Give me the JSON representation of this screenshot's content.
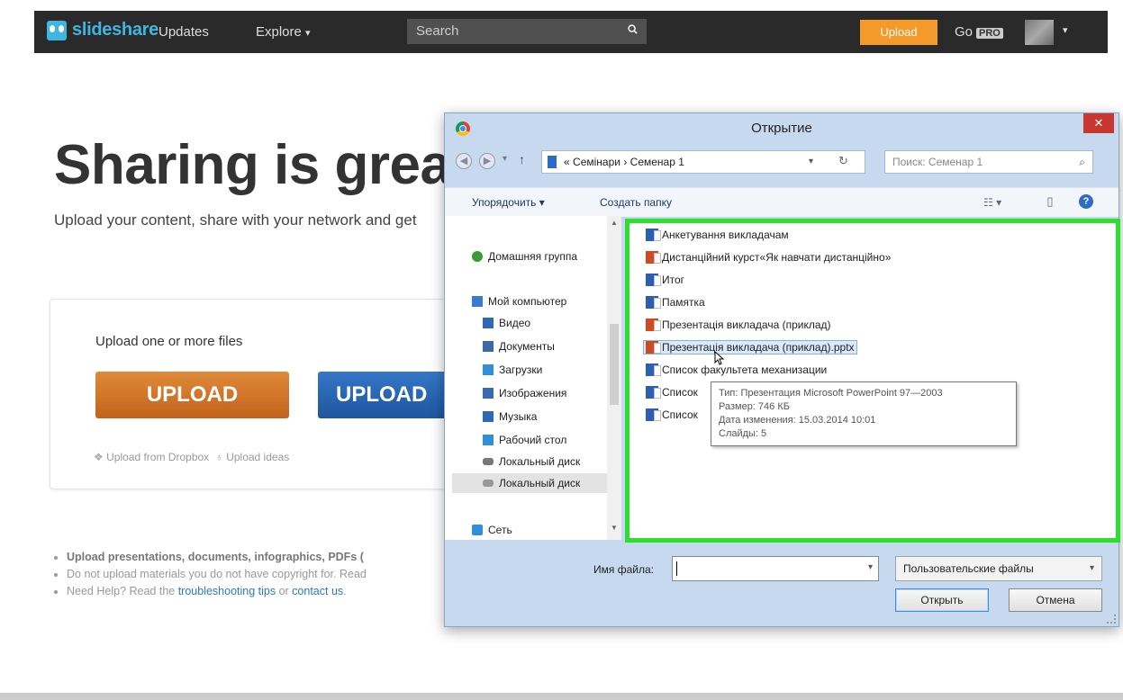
{
  "nav": {
    "logo": "slideshare",
    "updates": "Updates",
    "explore": "Explore",
    "explore_caret": "▾",
    "search_placeholder": "Search",
    "upload": "Upload",
    "go": "Go",
    "pro": "PRO",
    "avatar_caret": "▾"
  },
  "hero": {
    "title": "Sharing is great",
    "subtitle": "Upload your content, share with your network and get"
  },
  "card": {
    "title": "Upload one or more files",
    "upload_primary": "UPLOAD",
    "upload_secondary": "UPLOAD",
    "dropbox": "Upload from Dropbox",
    "ideas": "Upload ideas"
  },
  "tips": [
    {
      "strong": "Upload presentations, documents, infographics, PDFs (",
      "rest": ""
    },
    {
      "strong": "",
      "rest": "Do not upload materials you do not have copyright for. Read"
    },
    {
      "strong": "",
      "rest": "Need Help? Read the ",
      "link1": "troubleshooting tips",
      "mid": " or ",
      "link2": "contact us",
      "end": "."
    }
  ],
  "dialog": {
    "title": "Открытие",
    "close": "✕",
    "back": "◀",
    "forward": "▶",
    "down": "▾",
    "up": "↑",
    "path_prefix": "«",
    "path1": "Семінари",
    "path_sep": "›",
    "path2": "Семенар 1",
    "path_dd": "▾",
    "refresh": "↻",
    "search_placeholder": "Поиск: Семенар 1",
    "search_icon": "⌕",
    "organize": "Упорядочить ▾",
    "new_folder": "Создать папку",
    "view_icon": "☷ ▾",
    "pane_icon": "▯",
    "help_icon": "?",
    "nav_items": [
      {
        "label": "Домашняя группа",
        "color": "#3a9a3a"
      },
      {
        "label": "Мой компьютер",
        "color": "#3a7ad0"
      },
      {
        "label": "Видео",
        "color": "#2c6ab8"
      },
      {
        "label": "Документы",
        "color": "#3b6aa8"
      },
      {
        "label": "Загрузки",
        "color": "#2f8fd8"
      },
      {
        "label": "Изображения",
        "color": "#3a6ab0"
      },
      {
        "label": "Музыка",
        "color": "#2c6ab8"
      },
      {
        "label": "Рабочий стол",
        "color": "#2f8fd8"
      },
      {
        "label": "Локальный диск",
        "color": "#777"
      },
      {
        "label": "Локальный диск",
        "color": "#999"
      },
      {
        "label": "Сеть",
        "color": "#2f8fd8"
      }
    ],
    "files": [
      {
        "name": "Анкетування викладачам",
        "type": "word"
      },
      {
        "name": "Дистанційний курст«Як навчати дистанційно»",
        "type": "ppt"
      },
      {
        "name": "Итог",
        "type": "word"
      },
      {
        "name": "Памятка",
        "type": "word"
      },
      {
        "name": "Презентація викладача (приклад)",
        "type": "ppt"
      },
      {
        "name": "Презентація викладача (приклад).pptx",
        "type": "ppt"
      },
      {
        "name": "Список факультета механизации",
        "type": "word"
      },
      {
        "name": "Список",
        "type": "word"
      },
      {
        "name": "Список",
        "type": "word"
      }
    ],
    "tooltip": {
      "type": "Тип: Презентация Microsoft PowerPoint 97—2003",
      "size": "Размер: 746 КБ",
      "modified": "Дата изменения: 15.03.2014 10:01",
      "slides": "Слайды: 5"
    },
    "filename_label": "Имя файла:",
    "filename_value": "",
    "filter": "Пользовательские файлы",
    "open": "Открыть",
    "cancel": "Отмена"
  },
  "colors": {
    "nav_bg": "#2a2a2a",
    "logo": "#3fb6e0",
    "upload_orange": "#f49a2b",
    "highlight_green": "#2ee02e"
  }
}
